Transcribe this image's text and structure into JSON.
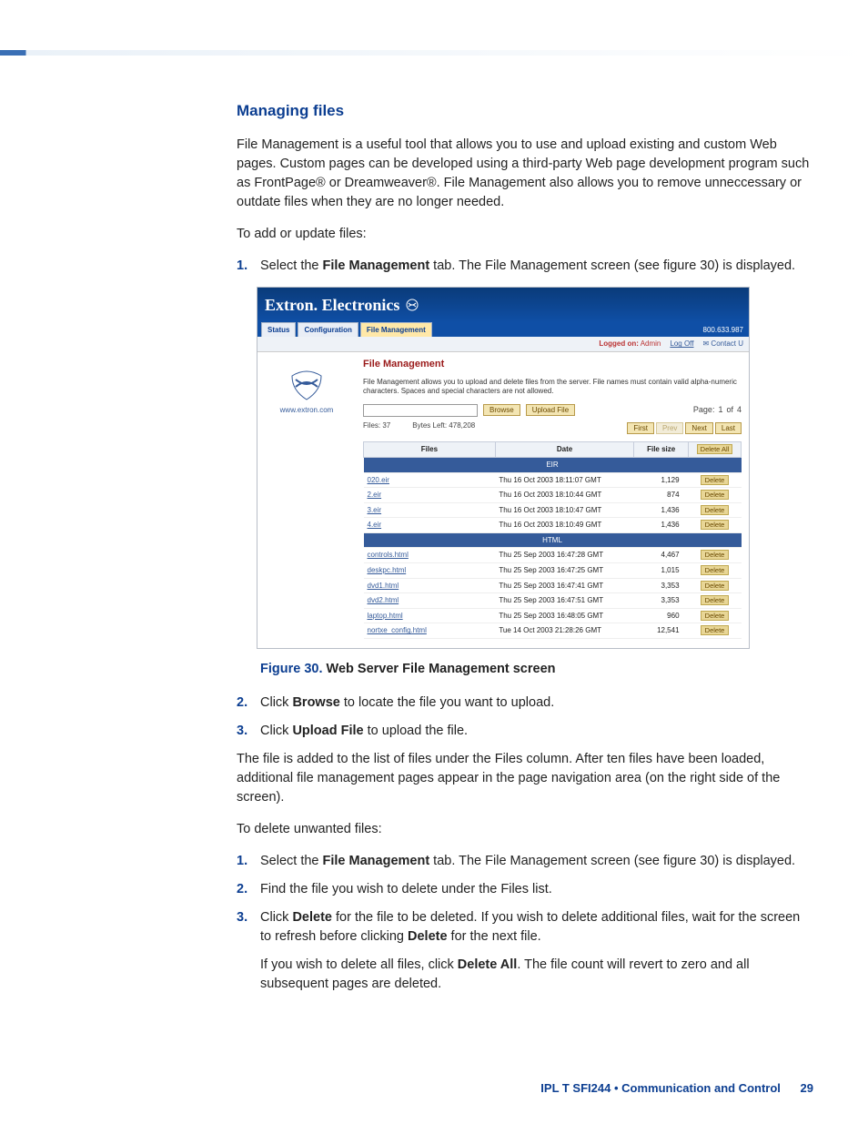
{
  "section_title": "Managing files",
  "intro": "File Management is a useful tool that allows you to use and upload existing and custom Web pages.  Custom pages can be developed using a third-party Web page development program such as FrontPage® or Dreamweaver®.  File Management also allows you to remove unneccessary or outdate files when they are no longer needed.",
  "add_intro": "To add or update files:",
  "add_steps": {
    "s1a": "Select the ",
    "s1b": "File Management",
    "s1c": " tab.  The File Management screen (see figure 30) is displayed.",
    "s2a": "Click ",
    "s2b": "Browse",
    "s2c": " to locate the file you want to upload.",
    "s3a": "Click ",
    "s3b": "Upload File",
    "s3c": " to upload the file."
  },
  "after_add": "The file is added to the list of files under the Files column.  After ten files have been loaded, additional file management pages appear in the page navigation area (on the right side of the screen).",
  "del_intro": "To delete unwanted files:",
  "del_steps": {
    "s1a": "Select the ",
    "s1b": "File Management",
    "s1c": " tab.  The File Management screen (see figure 30) is displayed.",
    "s2": "Find the file you wish to delete under the Files list.",
    "s3a": "Click ",
    "s3b": "Delete",
    "s3c": " for the file to be deleted.  If you wish to delete additional files, wait for the screen to refresh before clicking ",
    "s3d": "Delete",
    "s3e": " for the next file.",
    "s3f": "If you wish to delete all files, click ",
    "s3g": "Delete All",
    "s3h": ".  The file count will revert to zero and all subsequent pages are deleted."
  },
  "figure": {
    "caption_label": "Figure 30.",
    "caption_text": " Web Server File Management screen",
    "brand": "Extron. Electronics",
    "tabs": [
      "Status",
      "Configuration",
      "File Management"
    ],
    "phone": "800.633.987",
    "logged_label": "Logged on:",
    "logged_user": "Admin",
    "logoff": "Log Off",
    "contact": "Contact U",
    "site": "www.extron.com",
    "panel_title": "File Management",
    "panel_desc": "File Management allows you to upload and delete files from the server. File names must contain valid alpha-numeric characters. Spaces and special characters are not allowed.",
    "browse": "Browse",
    "upload": "Upload File",
    "page_label": "Page:",
    "page_cur": "1",
    "page_of": "of",
    "page_total": "4",
    "files_label": "Files:",
    "files_count": "37",
    "bytes_label": "Bytes Left:",
    "bytes_val": "478,208",
    "nav": {
      "first": "First",
      "prev": "Prev",
      "next": "Next",
      "last": "Last"
    },
    "cols": {
      "files": "Files",
      "date": "Date",
      "size": "File size",
      "delall": "Delete All"
    },
    "groups": {
      "eir": "EIR",
      "html": "HTML"
    },
    "rows_eir": [
      {
        "name": "020.eir",
        "date": "Thu 16 Oct 2003 18:11:07 GMT",
        "size": "1,129"
      },
      {
        "name": "2.eir",
        "date": "Thu 16 Oct 2003 18:10:44 GMT",
        "size": "874"
      },
      {
        "name": "3.eir",
        "date": "Thu 16 Oct 2003 18:10:47 GMT",
        "size": "1,436"
      },
      {
        "name": "4.eir",
        "date": "Thu 16 Oct 2003 18:10:49 GMT",
        "size": "1,436"
      }
    ],
    "rows_html": [
      {
        "name": "controls.html",
        "date": "Thu 25 Sep 2003 16:47:28 GMT",
        "size": "4,467"
      },
      {
        "name": "deskpc.html",
        "date": "Thu 25 Sep 2003 16:47:25 GMT",
        "size": "1,015"
      },
      {
        "name": "dvd1.html",
        "date": "Thu 25 Sep 2003 16:47:41 GMT",
        "size": "3,353"
      },
      {
        "name": "dvd2.html",
        "date": "Thu 25 Sep 2003 16:47:51 GMT",
        "size": "3,353"
      },
      {
        "name": "laptop.html",
        "date": "Thu 25 Sep 2003 16:48:05 GMT",
        "size": "960"
      },
      {
        "name": "nortxe_config.html",
        "date": "Tue 14 Oct 2003 21:28:26 GMT",
        "size": "12,541"
      }
    ],
    "delete": "Delete"
  },
  "footer": {
    "text": "IPL T SFI244 • Communication and Control",
    "page": "29"
  }
}
